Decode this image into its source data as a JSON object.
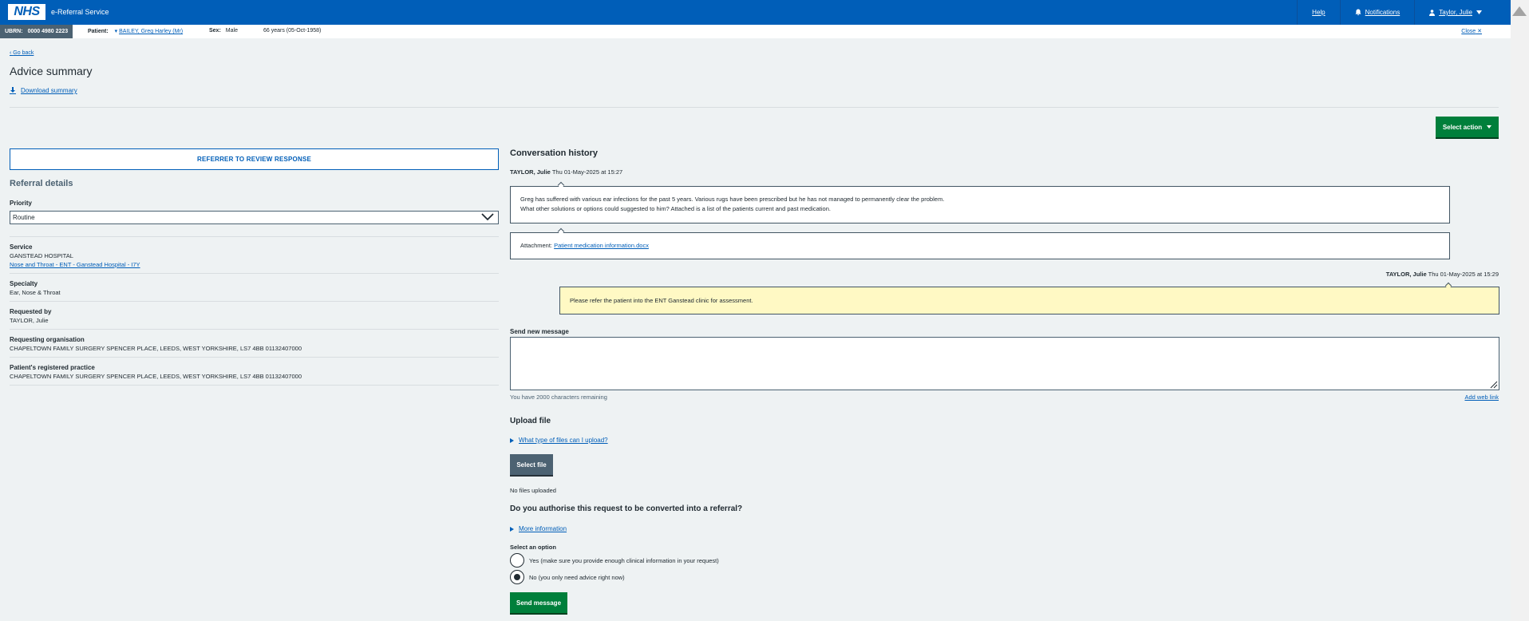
{
  "header": {
    "logo": "NHS",
    "service_name": "e-Referral Service",
    "nav": {
      "help": "Help",
      "notifications": "Notifications",
      "user": "Taylor, Julie"
    }
  },
  "patient_banner": {
    "ubrn_label": "UBRN:",
    "ubrn_value": "0000 4980 2223",
    "patient_label": "Patient:",
    "patient_name": "BAILEY, Greg Harley (Mr)",
    "sex_label": "Sex:",
    "sex_value": "Male",
    "age_dob": "66 years (05-Oct-1958)",
    "close": "Close"
  },
  "page": {
    "go_back": "Go back",
    "title": "Advice summary",
    "download": "Download summary",
    "select_action": "Select action",
    "status": "REFERRER TO REVIEW RESPONSE"
  },
  "referral": {
    "heading": "Referral details",
    "priority_label": "Priority",
    "priority_value": "Routine",
    "service_label": "Service",
    "service_value": "GANSTEAD HOSPITAL",
    "service_link": "Nose and Throat - ENT - Ganstead Hospital - I7Y",
    "specialty_label": "Specialty",
    "specialty_value": "Ear, Nose & Throat",
    "requested_by_label": "Requested by",
    "requested_by_value": "TAYLOR, Julie",
    "req_org_label": "Requesting organisation",
    "req_org_value": "CHAPELTOWN FAMILY SURGERY SPENCER PLACE, LEEDS, WEST YORKSHIRE, LS7 4BB 01132407000",
    "practice_label": "Patient's registered practice",
    "practice_value": "CHAPELTOWN FAMILY SURGERY SPENCER PLACE, LEEDS, WEST YORKSHIRE, LS7 4BB 01132407000"
  },
  "conversation": {
    "title": "Conversation history",
    "msg1_author": "TAYLOR, Julie",
    "msg1_time": "Thu 01-May-2025 at 15:27",
    "msg1_line1": "Greg has suffered with various ear infections for the past 5 years. Various rugs have been prescribed but he has not managed to permanently clear the problem.",
    "msg1_line2": "What other solutions or options could suggested to him? Attached is a list of the patients current and past medication.",
    "attachment_label": "Attachment:",
    "attachment_link": "Patient medication information.docx",
    "msg2_author": "TAYLOR, Julie",
    "msg2_time": "Thu 01-May-2025 at 15:29",
    "msg2_text": "Please refer the patient into the ENT Ganstead clinic for assessment."
  },
  "compose": {
    "label": "Send new message",
    "placeholder": "",
    "chars_remaining": "You have 2000 characters remaining",
    "add_web_link": "Add web link",
    "upload_heading": "Upload file",
    "file_types_link": "What type of files can I upload?",
    "select_file": "Select file",
    "no_files": "No files uploaded",
    "authorise_q": "Do you authorise this request to be converted into a referral?",
    "more_info": "More information",
    "select_option": "Select an option",
    "opt_yes": "Yes (make sure you provide enough clinical information in your request)",
    "opt_no": "No (you only need advice right now)",
    "send_button": "Send message"
  }
}
